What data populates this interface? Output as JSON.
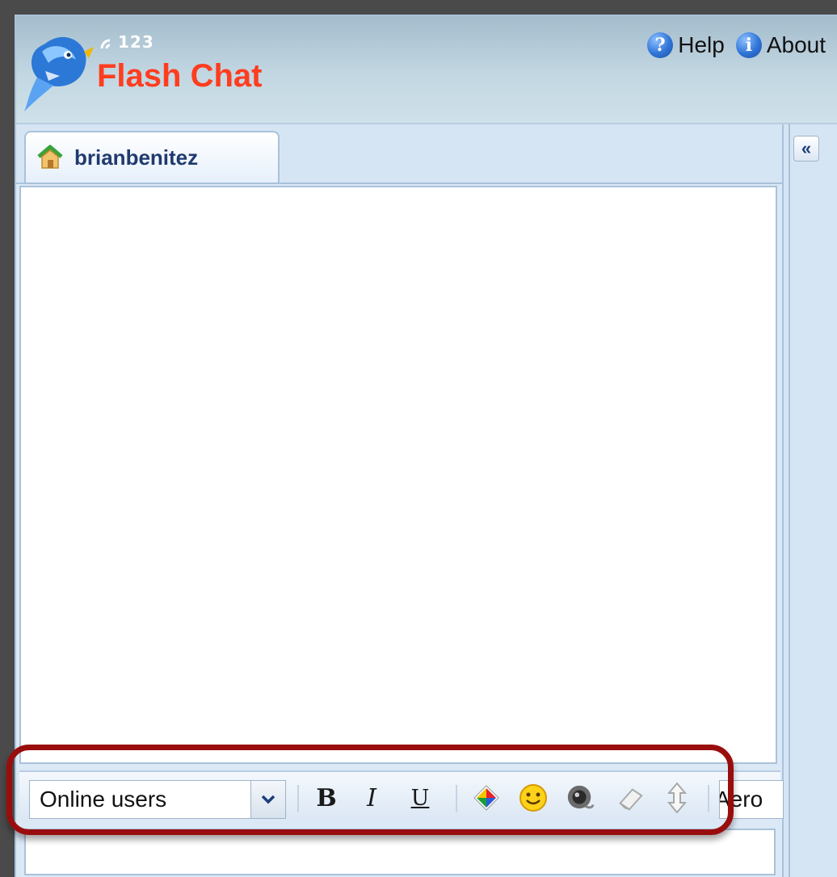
{
  "header": {
    "logo_number": "123",
    "logo_text": "Flash Chat",
    "help_label": "Help",
    "about_label": "About"
  },
  "tab": {
    "label": "brianbenitez"
  },
  "toolbar": {
    "recipient_select_value": "Online users",
    "bold_label": "B",
    "italic_label": "I",
    "underline_label": "U",
    "font_value": "Aero"
  },
  "colors": {
    "logo_text": "#ff3d1f",
    "highlight_border": "#9a0d0d",
    "tab_label": "#1f3a6e"
  }
}
